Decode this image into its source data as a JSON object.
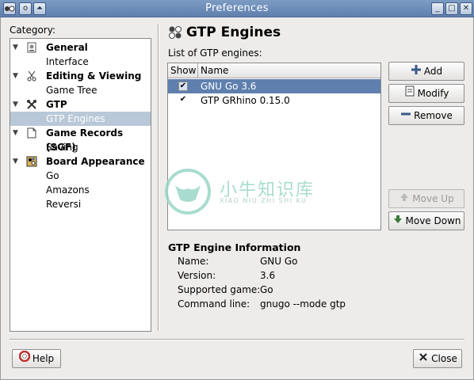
{
  "window": {
    "title": "Preferences"
  },
  "sidebar": {
    "label": "Category:",
    "items": [
      {
        "label": "General",
        "bold": true,
        "expanded": true,
        "icon": "general-icon"
      },
      {
        "label": "Interface",
        "bold": false
      },
      {
        "label": "Editing & Viewing",
        "bold": true,
        "expanded": true,
        "icon": "scissors-icon"
      },
      {
        "label": "Game Tree",
        "bold": false
      },
      {
        "label": "GTP",
        "bold": true,
        "expanded": true,
        "icon": "gtp-icon"
      },
      {
        "label": "GTP Engines",
        "bold": false,
        "selected": true
      },
      {
        "label": "Game Records (SGF)",
        "bold": true,
        "expanded": true,
        "icon": "document-icon"
      },
      {
        "label": "Saving",
        "bold": false
      },
      {
        "label": "Board Appearance",
        "bold": true,
        "expanded": true,
        "icon": "board-icon"
      },
      {
        "label": "Go",
        "bold": false
      },
      {
        "label": "Amazons",
        "bold": false
      },
      {
        "label": "Reversi",
        "bold": false
      }
    ]
  },
  "main": {
    "title": "GTP Engines",
    "list_label": "List of GTP engines:",
    "columns": {
      "show": "Show",
      "name": "Name"
    },
    "engines": [
      {
        "show": true,
        "name": "GNU Go 3.6",
        "selected": true
      },
      {
        "show": true,
        "name": "GTP GRhino 0.15.0",
        "selected": false
      }
    ],
    "buttons": {
      "add": "Add",
      "modify": "Modify",
      "remove": "Remove",
      "move_up": "Move Up",
      "move_down": "Move Down"
    },
    "info": {
      "title": "GTP Engine Information",
      "name_label": "Name:",
      "name_value": "GNU Go",
      "version_label": "Version:",
      "version_value": "3.6",
      "supported_label": "Supported game:",
      "supported_value": "Go",
      "command_label": "Command line:",
      "command_value": "gnugo --mode gtp"
    }
  },
  "footer": {
    "help": "Help",
    "close": "Close"
  },
  "watermark": {
    "text": "小牛知识库",
    "sub": "XIAO NIU ZHI SHI KU"
  },
  "colors": {
    "selection": "#5f80ae",
    "sidebar_selection": "#b8c8d8",
    "titlebar": "#6f8fbb"
  }
}
